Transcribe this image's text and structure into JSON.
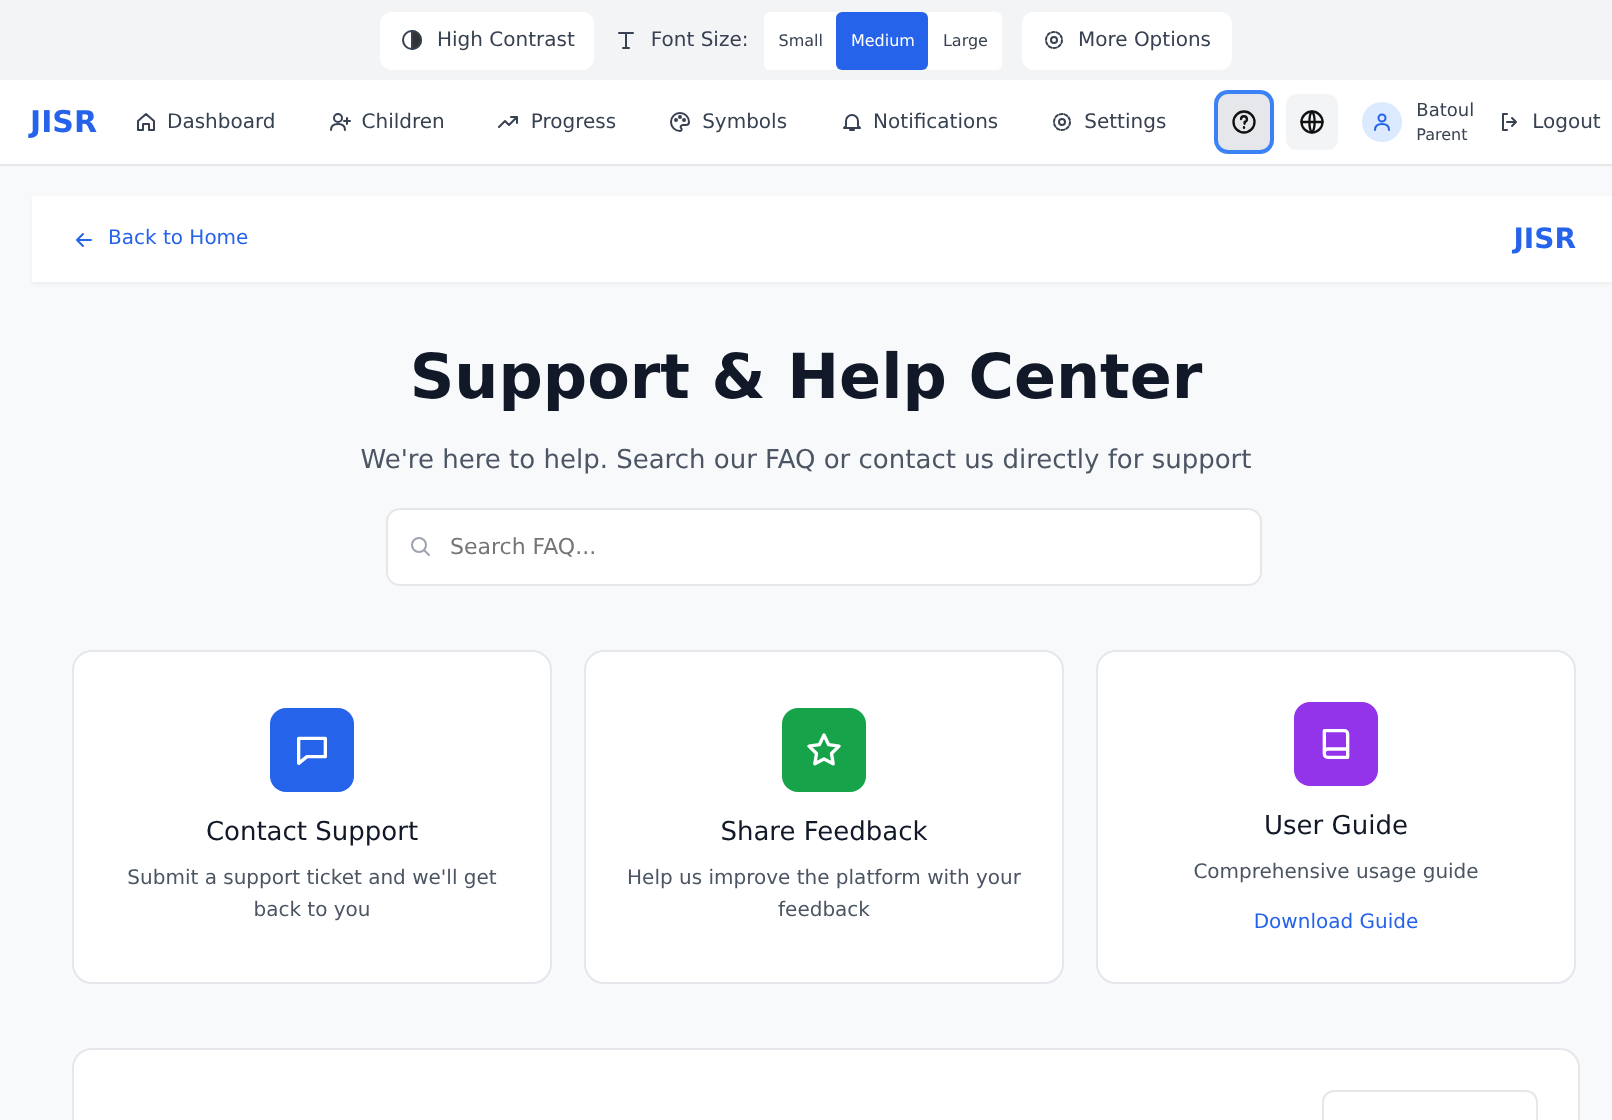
{
  "accessibility_bar": {
    "high_contrast": "High Contrast",
    "font_size_label": "Font Size:",
    "font_sizes": [
      {
        "label": "Small",
        "selected": false
      },
      {
        "label": "Medium",
        "selected": true
      },
      {
        "label": "Large",
        "selected": false
      }
    ],
    "more_options": "More Options"
  },
  "nav": {
    "logo": "JISR",
    "items": [
      {
        "label": "Dashboard",
        "kind": "home"
      },
      {
        "label": "Children",
        "kind": "children"
      },
      {
        "label": "Progress",
        "kind": "progress"
      },
      {
        "label": "Symbols",
        "kind": "symbols"
      },
      {
        "label": "Notifications",
        "kind": "notifications"
      },
      {
        "label": "Settings",
        "kind": "settings"
      }
    ],
    "tools": [
      {
        "kind": "help",
        "selected": true
      },
      {
        "kind": "language",
        "selected": false
      }
    ],
    "user": {
      "name": "Batoul",
      "role": "Parent"
    },
    "logout": "Logout"
  },
  "back_bar": {
    "back": "Back to Home",
    "logo": "JISR"
  },
  "hero": {
    "title": "Support & Help Center",
    "subtitle": "We're here to help. Search our FAQ or contact us directly for support",
    "search": {
      "placeholder": "Search FAQ..."
    }
  },
  "cards": [
    {
      "kind": "contact",
      "color": "#2563eb",
      "title": "Contact Support",
      "text": "Submit a support ticket and we'll get back to you"
    },
    {
      "kind": "feedback",
      "color": "#16a34a",
      "title": "Share Feedback",
      "text": "Help us improve the platform with your feedback"
    },
    {
      "kind": "guide",
      "color": "#9333ea",
      "title": "User Guide",
      "text": "Comprehensive usage guide",
      "link": "Download Guide"
    }
  ]
}
